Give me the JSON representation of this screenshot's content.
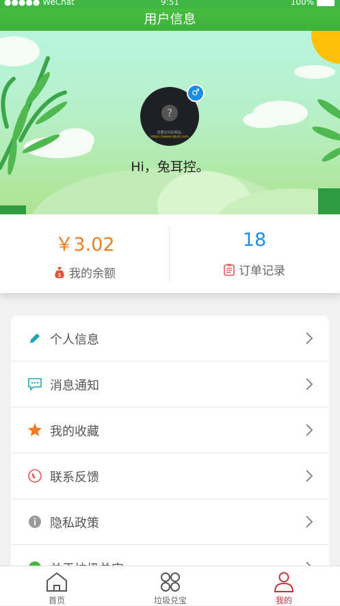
{
  "status_bar": {
    "carrier": "●●●●● WeChat",
    "time": "9:51",
    "battery": "100%"
  },
  "header": {
    "title": "用户信息"
  },
  "profile": {
    "greeting": "Hi，兔耳控。",
    "avatar_text_1": "您要访问的网站:",
    "avatar_text_2": "https://www.iqiub.com"
  },
  "stats": {
    "balance_value": "￥3.02",
    "balance_label": "我的余额",
    "orders_value": "18",
    "orders_label": "订单记录"
  },
  "menu": [
    {
      "label": "个人信息",
      "icon": "pencil-icon"
    },
    {
      "label": "消息通知",
      "icon": "message-icon"
    },
    {
      "label": "我的收藏",
      "icon": "star-icon"
    },
    {
      "label": "联系反馈",
      "icon": "phone-icon"
    },
    {
      "label": "隐私政策",
      "icon": "info-icon"
    },
    {
      "label": "关于垃圾兑宝",
      "icon": "about-icon"
    }
  ],
  "tabbar": [
    {
      "label": "首页",
      "icon": "home-icon"
    },
    {
      "label": "垃圾兑宝",
      "icon": "grid-icon"
    },
    {
      "label": "我的",
      "icon": "user-icon"
    }
  ],
  "colors": {
    "brand_green": "#3fb843",
    "balance_orange": "#f07d22",
    "orders_blue": "#1b8de6",
    "active_tab": "#c8323a"
  }
}
